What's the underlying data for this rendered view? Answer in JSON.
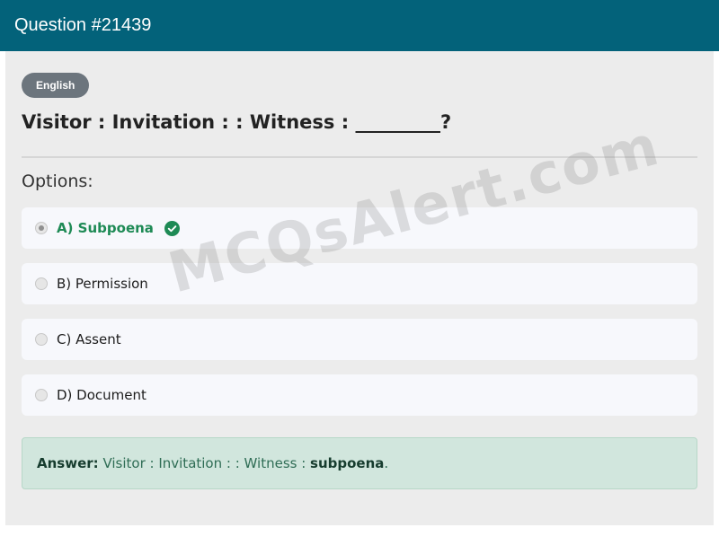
{
  "header": {
    "title": "Question #21439"
  },
  "badge": {
    "label": "English"
  },
  "question": {
    "text": "Visitor : Invitation : : Witness : _________?"
  },
  "options_label": "Options:",
  "options": [
    {
      "label": "A) Subpoena",
      "selected": true,
      "correct": true
    },
    {
      "label": "B) Permission",
      "selected": false,
      "correct": false
    },
    {
      "label": "C) Assent",
      "selected": false,
      "correct": false
    },
    {
      "label": "D) Document",
      "selected": false,
      "correct": false
    }
  ],
  "answer": {
    "prefix": "Answer:",
    "text": "Visitor : Invitation : : Witness :",
    "value": "subpoena",
    "suffix": "."
  },
  "watermark": "MCQsAlert.com",
  "colors": {
    "header_bg": "#03627a",
    "correct": "#1e8a55",
    "answer_bg": "#d1e6dd",
    "badge_bg": "#6c757d"
  },
  "icons": {
    "correct": "check-circle-icon"
  }
}
